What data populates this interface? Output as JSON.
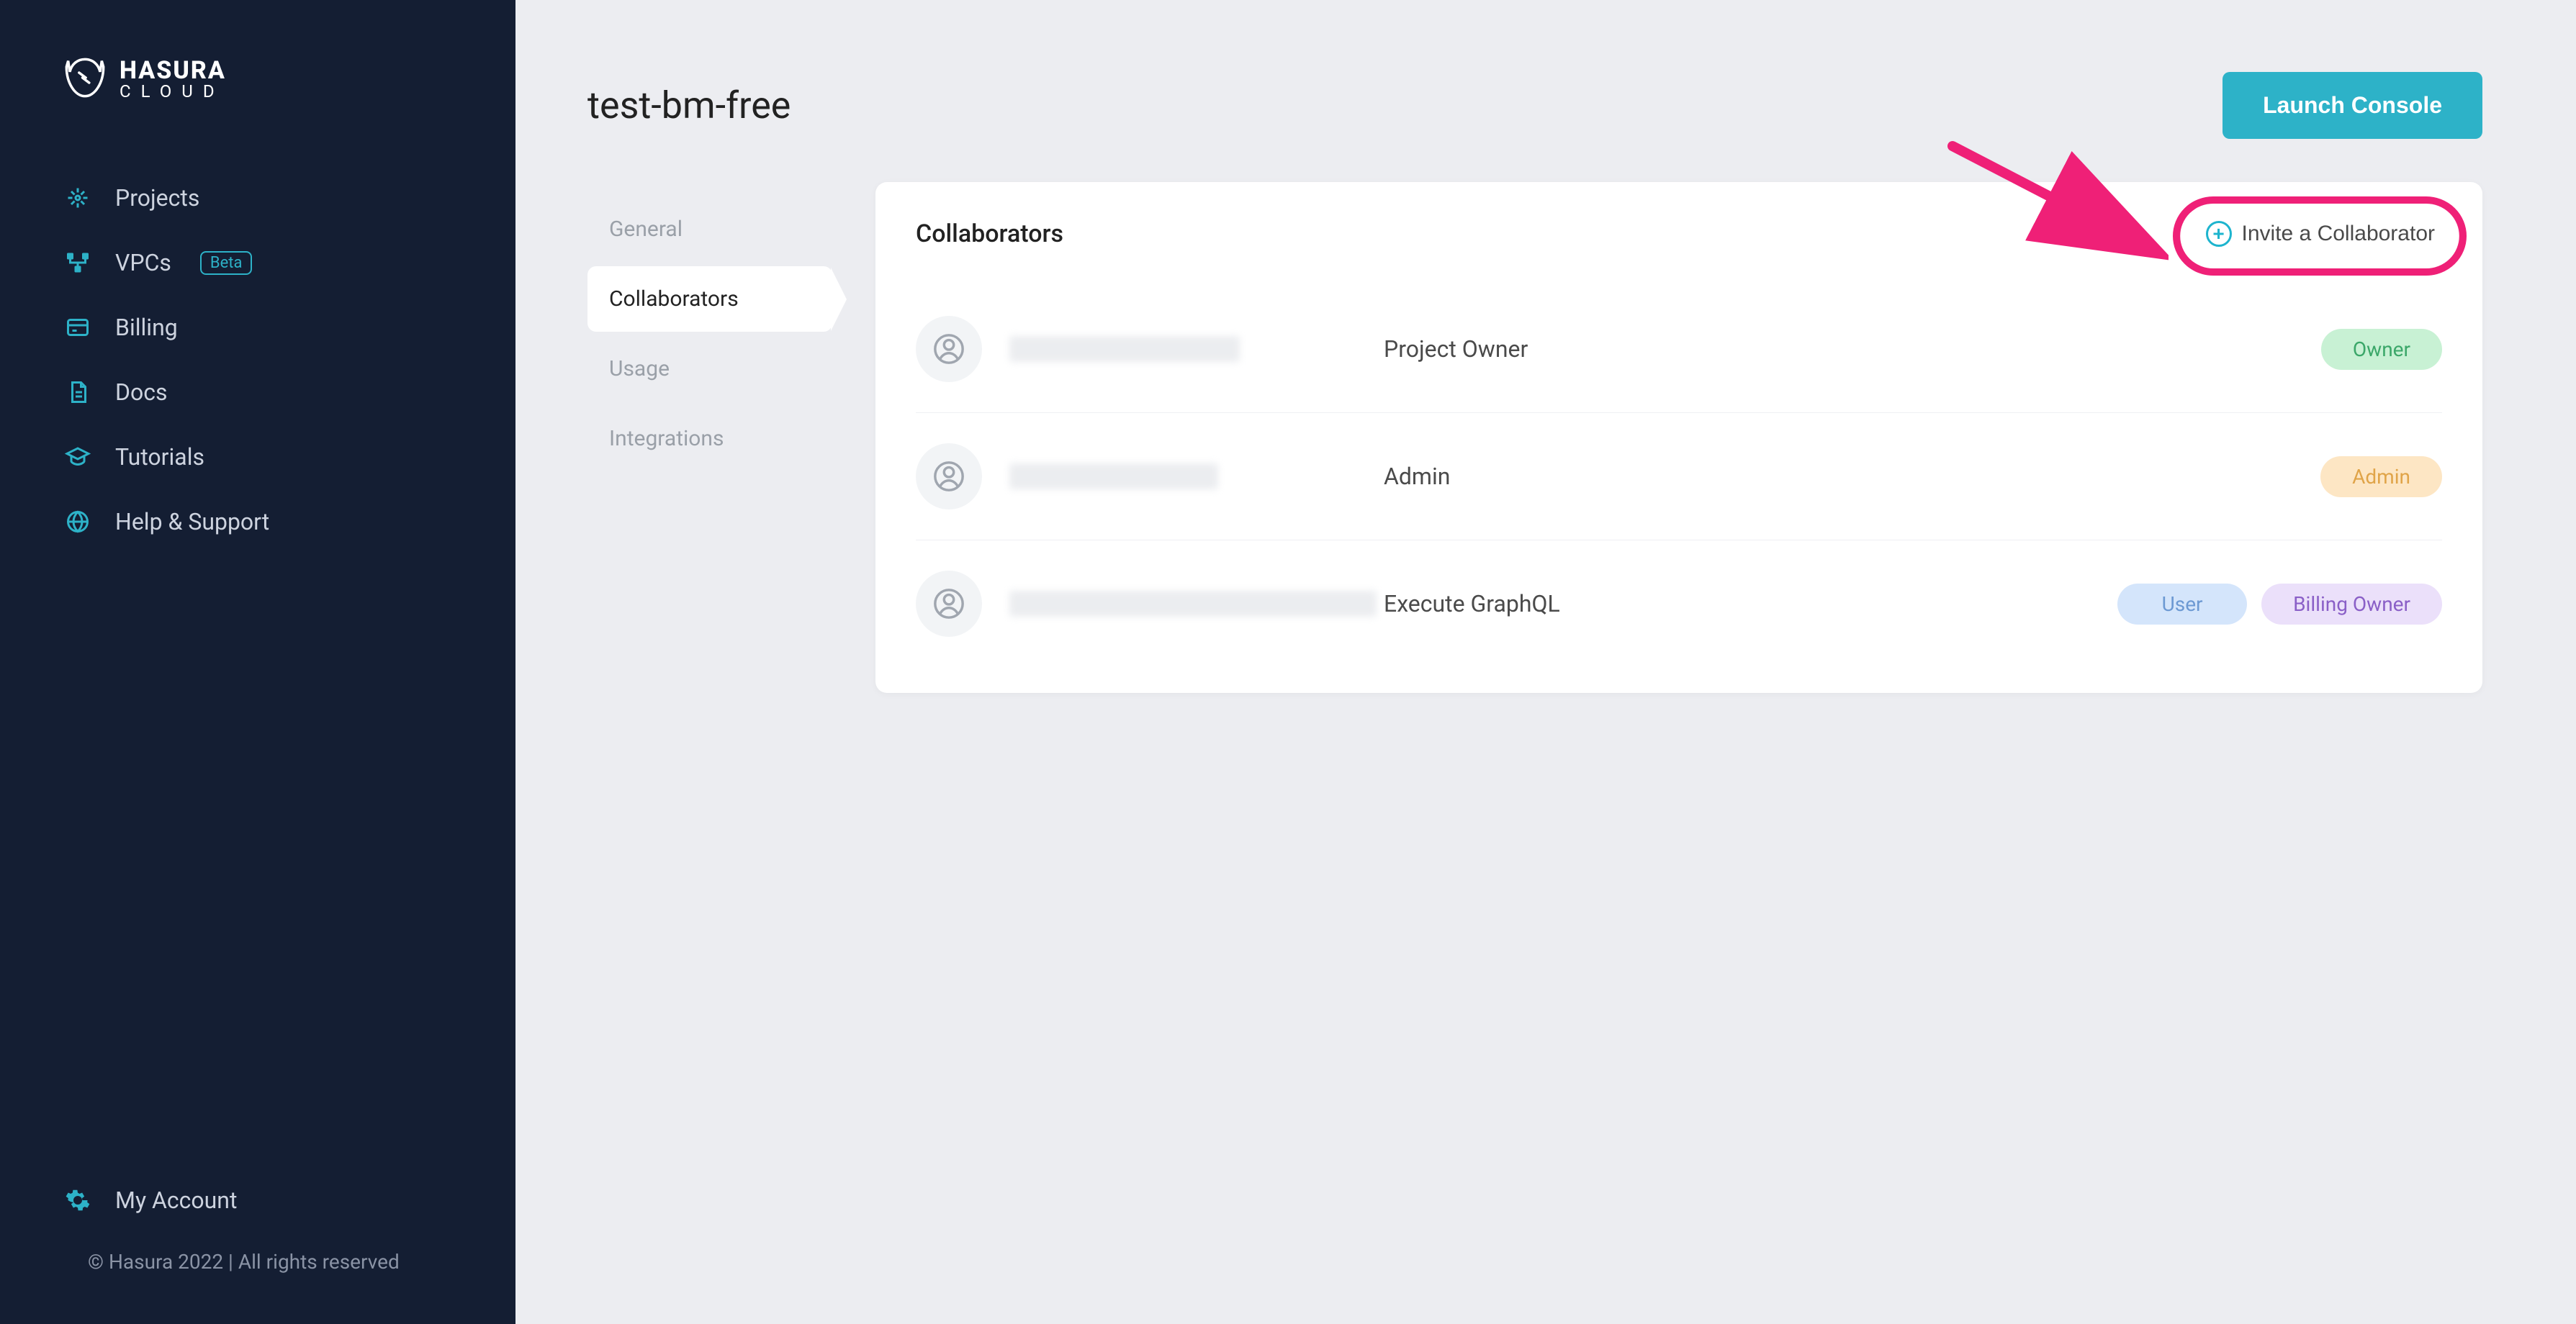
{
  "brand": {
    "line1": "HASURA",
    "line2": "CLOUD"
  },
  "sidebar": {
    "items": [
      {
        "label": "Projects",
        "icon": "sparkle"
      },
      {
        "label": "VPCs",
        "icon": "network",
        "badge": "Beta"
      },
      {
        "label": "Billing",
        "icon": "card"
      },
      {
        "label": "Docs",
        "icon": "doc"
      },
      {
        "label": "Tutorials",
        "icon": "grad"
      },
      {
        "label": "Help & Support",
        "icon": "globe"
      }
    ],
    "account": "My Account",
    "copyright": "© Hasura 2022   |   All rights reserved"
  },
  "page": {
    "title": "test-bm-free",
    "launch_button": "Launch Console"
  },
  "subnav": {
    "items": [
      {
        "label": "General",
        "active": false
      },
      {
        "label": "Collaborators",
        "active": true
      },
      {
        "label": "Usage",
        "active": false
      },
      {
        "label": "Integrations",
        "active": false
      }
    ]
  },
  "panel": {
    "title": "Collaborators",
    "invite_label": "Invite a Collaborator"
  },
  "collaborators": [
    {
      "email_redacted": true,
      "email_width": 320,
      "role_text": "Project Owner",
      "pills": [
        {
          "label": "Owner",
          "kind": "owner"
        }
      ]
    },
    {
      "email_redacted": true,
      "email_width": 290,
      "role_text": "Admin",
      "pills": [
        {
          "label": "Admin",
          "kind": "admin"
        }
      ]
    },
    {
      "email_redacted": true,
      "email_width": 510,
      "role_text": "Execute GraphQL",
      "pills": [
        {
          "label": "User",
          "kind": "user"
        },
        {
          "label": "Billing Owner",
          "kind": "billing"
        }
      ]
    }
  ],
  "annotation": {
    "highlight_target": "invite-button",
    "arrow_color": "#ef2077"
  }
}
